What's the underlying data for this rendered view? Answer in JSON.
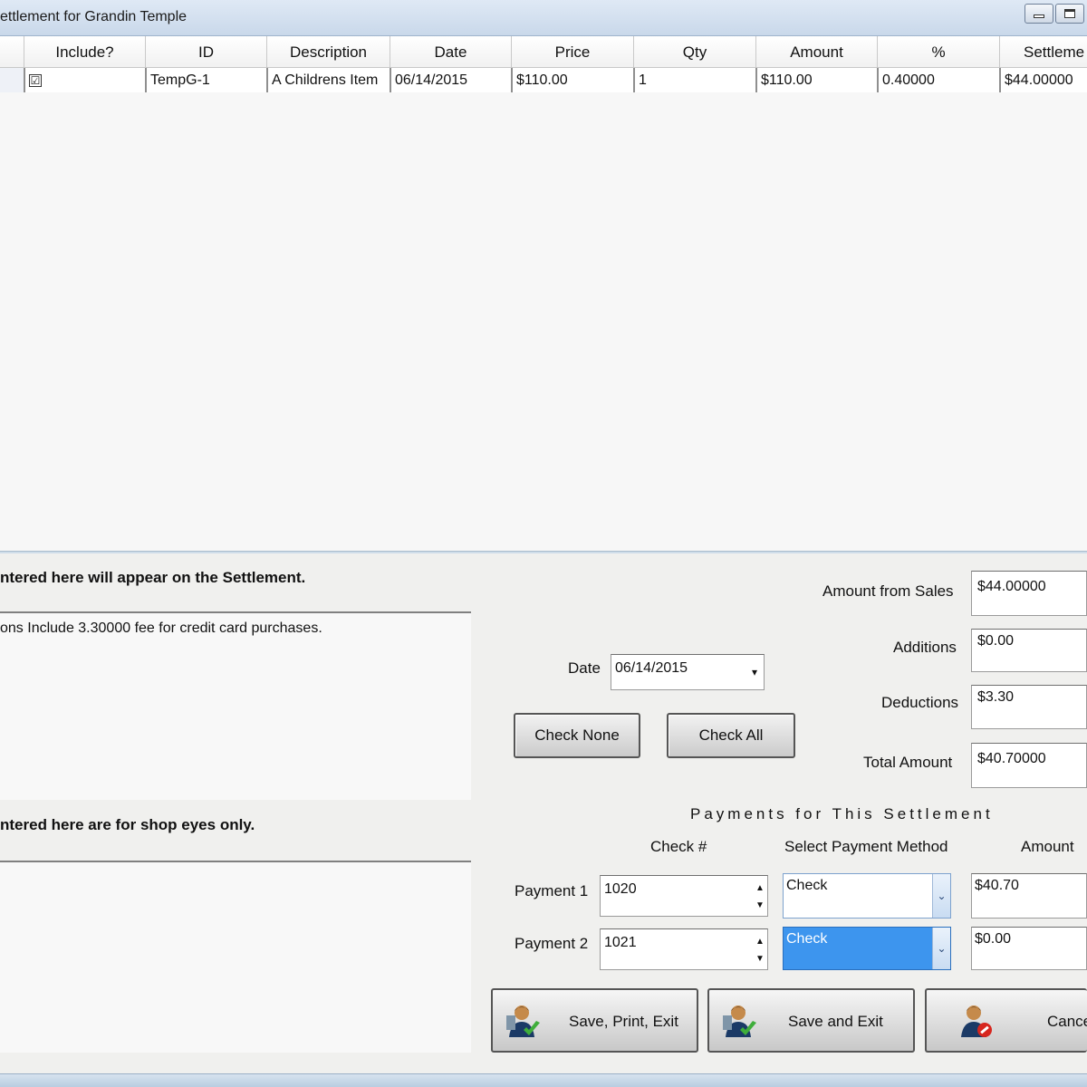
{
  "window": {
    "title": "ettlement for Grandin Temple"
  },
  "grid": {
    "columns": [
      "Include?",
      "ID",
      "Description",
      "Date",
      "Price",
      "Qty",
      "Amount",
      "%",
      "Settleme"
    ],
    "rows": [
      {
        "include": "☑",
        "id": "TempG-1",
        "description": "A Childrens Item",
        "date": "06/14/2015",
        "price": "$110.00",
        "qty": "1",
        "amount": "$110.00",
        "percent": "0.40000",
        "settlement": "$44.00000"
      }
    ]
  },
  "notes": {
    "public_label": "ntered here will appear on the Settlement.",
    "public_text": "ons Include 3.30000 fee for credit card purchases.",
    "private_label": "ntered here are for shop eyes only.",
    "private_text": ""
  },
  "date_field": {
    "label": "Date",
    "value": "06/14/2015"
  },
  "buttons": {
    "check_none": "Check None",
    "check_all": "Check All",
    "save_print_exit": "Save, Print, Exit",
    "save_exit": "Save and Exit",
    "cancel": "Cance"
  },
  "totals": {
    "amount_from_sales_label": "Amount from Sales",
    "amount_from_sales": "$44.00000",
    "additions_label": "Additions",
    "additions": "$0.00",
    "deductions_label": "Deductions",
    "deductions": "$3.30",
    "total_amount_label": "Total Amount",
    "total_amount": "$40.70000"
  },
  "payments": {
    "title": "Payments for This Settlement",
    "col_check": "Check #",
    "col_method": "Select Payment Method",
    "col_amount": "Amount",
    "rows": [
      {
        "label": "Payment 1",
        "check": "1020",
        "method": "Check",
        "amount": "$40.70"
      },
      {
        "label": "Payment 2",
        "check": "1021",
        "method": "Check",
        "amount": "$0.00"
      }
    ]
  },
  "colors": {
    "selected_dropdown": "#3d95ee",
    "titlebar": "#c9d8ea"
  }
}
